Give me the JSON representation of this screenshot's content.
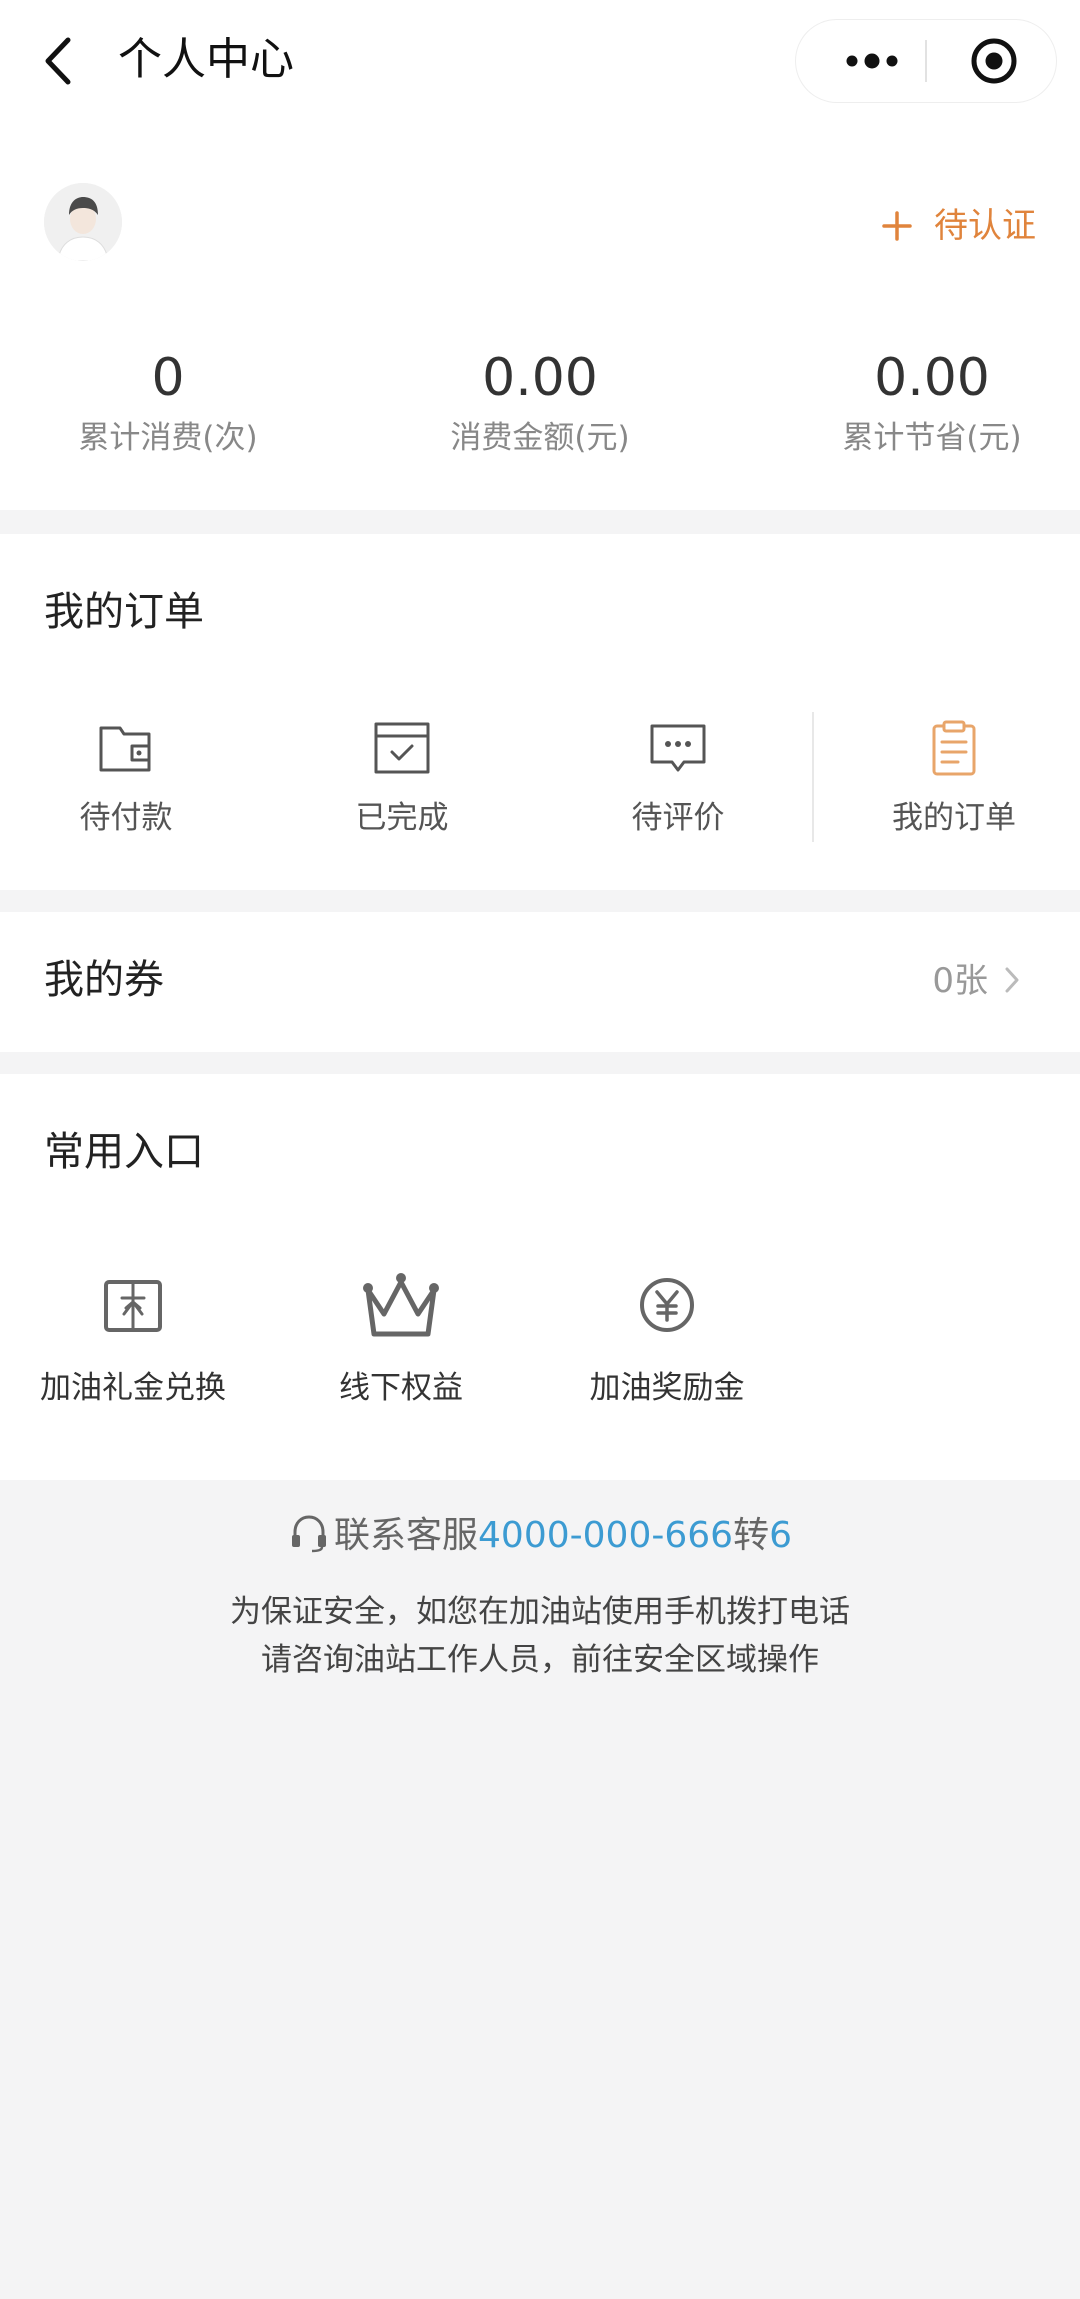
{
  "header": {
    "title": "个人中心",
    "back_icon": "chevron-left-icon",
    "more_icon": "more-dots-icon",
    "target_icon": "target-icon"
  },
  "profile": {
    "avatar_icon": "avatar-placeholder-icon",
    "verify_label": "待认证",
    "verify_icon": "plus-icon",
    "accent_color": "#e0843c",
    "stats": [
      {
        "value": "0",
        "label": "累计消费(次)"
      },
      {
        "value": "0.00",
        "label": "消费金额(元)"
      },
      {
        "value": "0.00",
        "label": "累计节省(元)"
      }
    ]
  },
  "orders": {
    "title": "我的订单",
    "items": [
      {
        "label": "待付款",
        "icon": "wallet-icon"
      },
      {
        "label": "已完成",
        "icon": "completed-box-icon"
      },
      {
        "label": "待评价",
        "icon": "comment-icon"
      },
      {
        "label": "我的订单",
        "icon": "clipboard-icon"
      }
    ]
  },
  "coupons": {
    "title": "我的券",
    "count": "0张",
    "chevron_icon": "chevron-right-icon"
  },
  "shortcuts": {
    "title": "常用入口",
    "items": [
      {
        "label": "加油礼金兑换",
        "icon": "gift-card-icon"
      },
      {
        "label": "线下权益",
        "icon": "crown-icon"
      },
      {
        "label": "加油奖励金",
        "icon": "yen-coin-icon"
      }
    ]
  },
  "footer": {
    "service_prefix": "联系客服",
    "service_number": "4000-000-666",
    "service_mid": "转",
    "service_ext": "6",
    "service_icon": "headset-icon",
    "link_color": "#3c9bd2",
    "notice_line1": "为保证安全，如您在加油站使用手机拨打电话",
    "notice_line2": "请咨询油站工作人员，前往安全区域操作"
  }
}
